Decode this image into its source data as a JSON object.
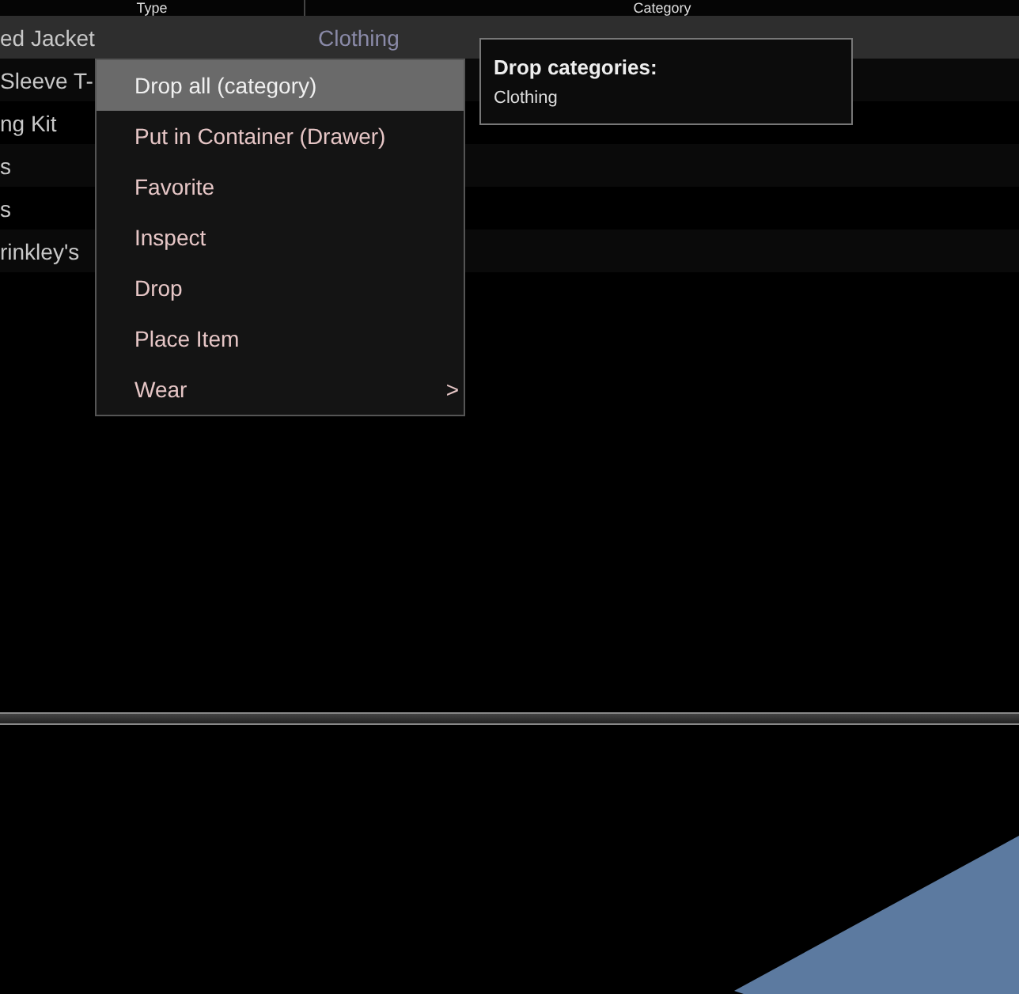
{
  "table": {
    "columns": [
      "Type",
      "Category"
    ],
    "rows": [
      {
        "name": "ed Jacket",
        "category": "Clothing",
        "selected": true
      },
      {
        "name": "Sleeve T-",
        "selected": false
      },
      {
        "name": "ng Kit",
        "selected": false
      },
      {
        "name": "s",
        "selected": false
      },
      {
        "name": "s",
        "selected": false
      },
      {
        "name": "rinkley's",
        "selected": false
      }
    ]
  },
  "context_menu": {
    "items": [
      {
        "label": "Drop all (category)",
        "selected": true
      },
      {
        "label": "Put in Container (Drawer)",
        "selected": false
      },
      {
        "label": "Favorite",
        "selected": false
      },
      {
        "label": "Inspect",
        "selected": false
      },
      {
        "label": "Drop",
        "selected": false
      },
      {
        "label": "Place Item",
        "selected": false
      },
      {
        "label": "Wear",
        "selected": false,
        "submenu": ">"
      }
    ]
  },
  "tooltip": {
    "title": "Drop categories:",
    "text": "Clothing"
  }
}
